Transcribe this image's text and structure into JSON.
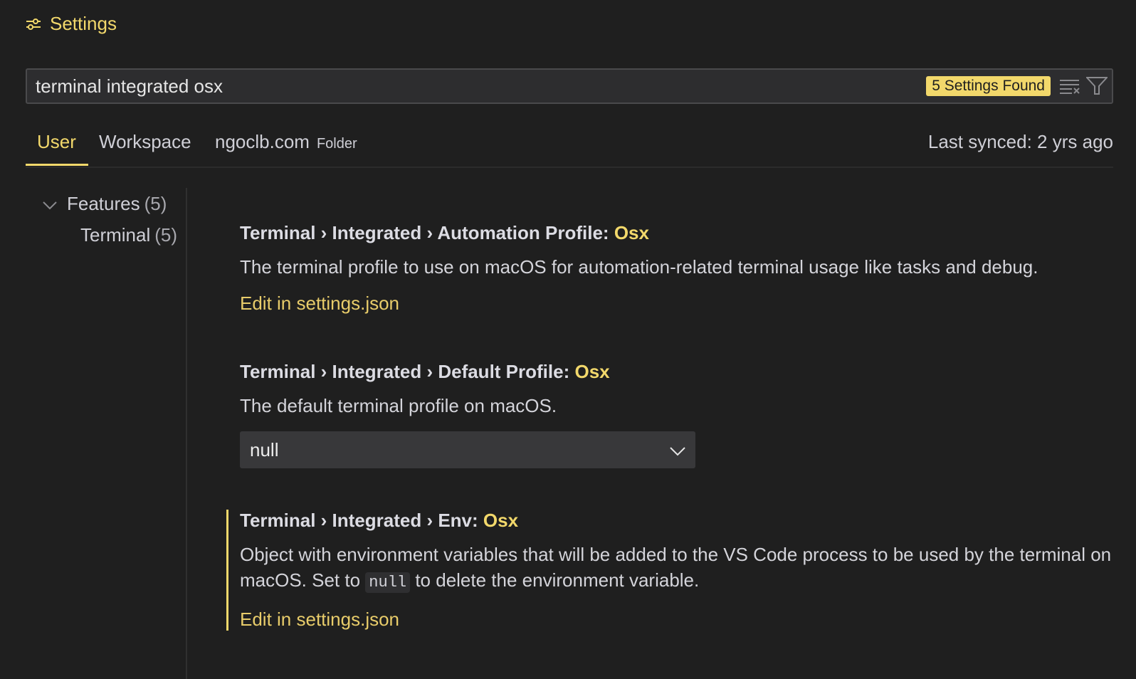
{
  "header": {
    "title": "Settings",
    "icon": "settings-sliders-icon"
  },
  "search": {
    "value": "terminal integrated osx",
    "placeholder": "Search settings",
    "results_badge": "5 Settings Found"
  },
  "tabs": [
    {
      "label": "User",
      "active": true
    },
    {
      "label": "Workspace",
      "active": false
    },
    {
      "label": "ngoclb.com",
      "sublabel": "Folder",
      "active": false
    }
  ],
  "sync_status": "Last synced: 2 yrs ago",
  "toc": {
    "items": [
      {
        "label": "Features",
        "count": "(5)",
        "expanded": true
      },
      {
        "label": "Terminal",
        "count": "(5)"
      }
    ]
  },
  "settings": [
    {
      "title_prefix": "Terminal › Integrated › Automation Profile: ",
      "title_key": "Osx",
      "description": "The terminal profile to use on macOS for automation-related terminal usage like tasks and debug.",
      "link": "Edit in settings.json"
    },
    {
      "title_prefix": "Terminal › Integrated › Default Profile: ",
      "title_key": "Osx",
      "description": "The default terminal profile on macOS.",
      "select_value": "null"
    },
    {
      "title_prefix": "Terminal › Integrated › Env: ",
      "title_key": "Osx",
      "description_pre": "Object with environment variables that will be added to the VS Code process to be used by the terminal on macOS. Set to ",
      "description_code": "null",
      "description_post": " to delete the environment variable.",
      "link": "Edit in settings.json"
    }
  ],
  "colors": {
    "accent": "#f2d86b",
    "background": "#1f1f1f",
    "link": "#e8cc6a"
  }
}
